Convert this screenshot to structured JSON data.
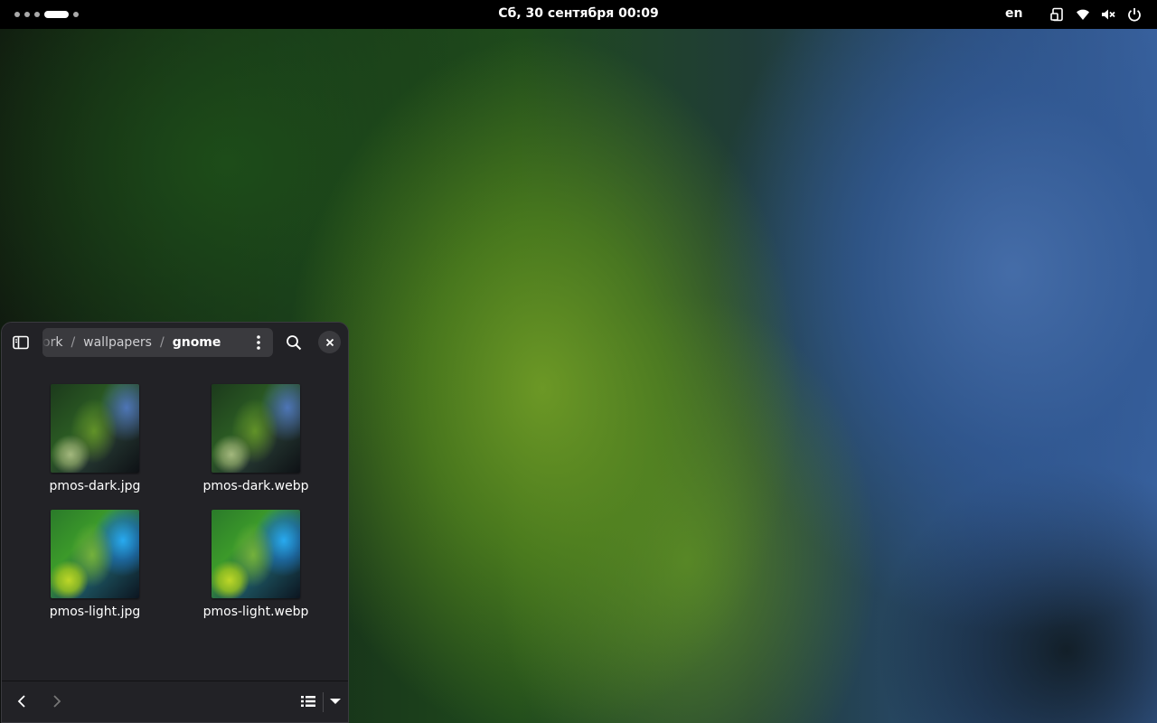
{
  "topbar": {
    "clock": "Сб, 30 сентября  00:09",
    "keyboard_layout": "en",
    "icons": [
      "screen-rotation-icon",
      "wifi-icon",
      "volume-muted-icon",
      "power-icon"
    ]
  },
  "file_chooser": {
    "path": [
      "ork",
      "wallpapers",
      "gnome"
    ],
    "path_separator": "/",
    "files": [
      {
        "name": "pmos-dark.jpg",
        "variant": "dark"
      },
      {
        "name": "pmos-dark.webp",
        "variant": "dark"
      },
      {
        "name": "pmos-light.jpg",
        "variant": "light"
      },
      {
        "name": "pmos-light.webp",
        "variant": "light"
      }
    ]
  },
  "colors": {
    "topbar_bg": "#000000",
    "window_bg": "#222226",
    "pathbar_bg": "#3a3a3e"
  }
}
